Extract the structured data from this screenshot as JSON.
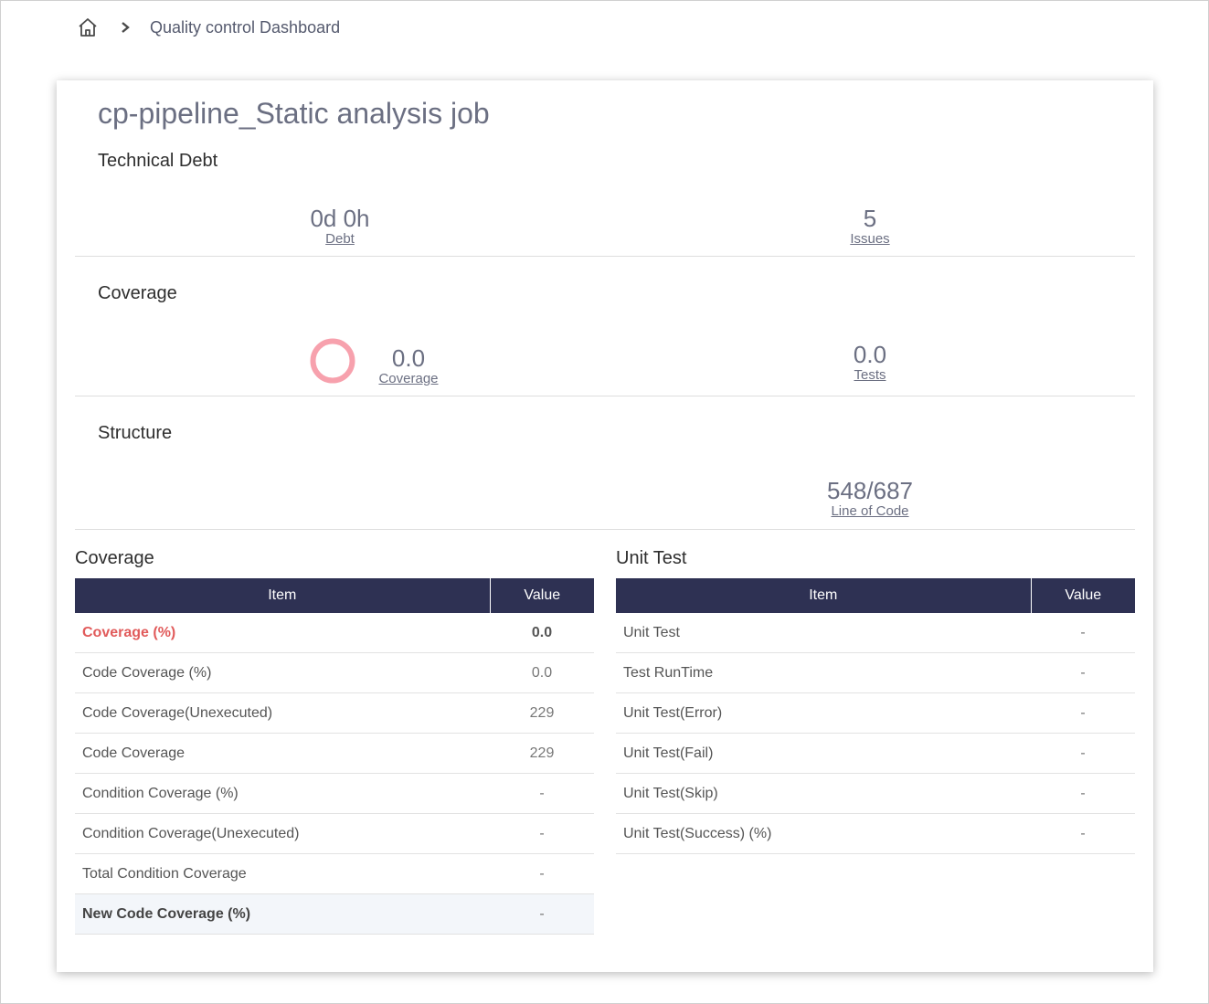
{
  "breadcrumb": {
    "home_icon": "home-icon",
    "separator_icon": "chevron-right-icon",
    "current": "Quality control Dashboard"
  },
  "job": {
    "title": "cp-pipeline_Static analysis job"
  },
  "technical_debt": {
    "title": "Technical Debt",
    "debt": {
      "value": "0d 0h",
      "label": "Debt"
    },
    "issues": {
      "value": "5",
      "label": "Issues"
    }
  },
  "coverage_summary": {
    "title": "Coverage",
    "coverage": {
      "value": "0.0",
      "label": "Coverage",
      "ring_color": "#f7a1ad"
    },
    "tests": {
      "value": "0.0",
      "label": "Tests"
    }
  },
  "structure": {
    "title": "Structure",
    "lines": {
      "value": "548/687",
      "label": "Line of Code"
    }
  },
  "coverage_table": {
    "title": "Coverage",
    "headers": {
      "item": "Item",
      "value": "Value"
    },
    "rows": [
      {
        "item": "Coverage (%)",
        "value": "0.0"
      },
      {
        "item": "Code Coverage (%)",
        "value": "0.0"
      },
      {
        "item": "Code Coverage(Unexecuted)",
        "value": "229"
      },
      {
        "item": "Code Coverage",
        "value": "229"
      },
      {
        "item": "Condition Coverage (%)",
        "value": "-"
      },
      {
        "item": "Condition Coverage(Unexecuted)",
        "value": "-"
      },
      {
        "item": "Total Condition Coverage",
        "value": "-"
      },
      {
        "item": "New Code Coverage (%)",
        "value": "-"
      }
    ]
  },
  "unit_test_table": {
    "title": "Unit Test",
    "headers": {
      "item": "Item",
      "value": "Value"
    },
    "rows": [
      {
        "item": "Unit Test",
        "value": "-"
      },
      {
        "item": "Test RunTime",
        "value": "-"
      },
      {
        "item": "Unit Test(Error)",
        "value": "-"
      },
      {
        "item": "Unit Test(Fail)",
        "value": "-"
      },
      {
        "item": "Unit Test(Skip)",
        "value": "-"
      },
      {
        "item": "Unit Test(Success) (%)",
        "value": "-"
      }
    ]
  },
  "colors": {
    "header_bg": "#2e3153",
    "highlight_text": "#e15b5b",
    "muted_text": "#6b6f82"
  }
}
